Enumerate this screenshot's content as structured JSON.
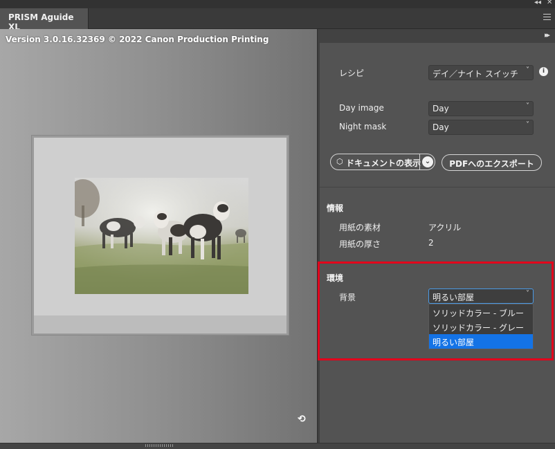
{
  "window": {
    "tab_title": "PRISM Aguide XL",
    "double_chevron": "◂◂",
    "close": "✕"
  },
  "preview": {
    "version_text": "Version 3.0.16.32369 © 2022 Canon Production Printing",
    "rotate_icon": "⟲"
  },
  "panel": {
    "collapse": "▸▸"
  },
  "recipe": {
    "label": "レシピ",
    "value": "デイ／ナイト スイッチ",
    "info": "i"
  },
  "day_image": {
    "label": "Day image",
    "value": "Day"
  },
  "night_mask": {
    "label": "Night mask",
    "value": "Day"
  },
  "buttons": {
    "show_document": "ドキュメントの表示",
    "export_pdf": "PDFへのエクスポート"
  },
  "info": {
    "title": "情報",
    "rows": [
      {
        "label": "用紙の素材",
        "value": "アクリル"
      },
      {
        "label": "用紙の厚さ",
        "value": "2"
      }
    ]
  },
  "environment": {
    "title": "環境",
    "background_label": "背景",
    "background_value": "明るい部屋",
    "options": [
      "ソリッドカラー - ブルー",
      "ソリッドカラー - グレー",
      "明るい部屋"
    ],
    "selected_index": 2
  },
  "icons": {
    "chevron": "˅",
    "cube": "⬡"
  }
}
